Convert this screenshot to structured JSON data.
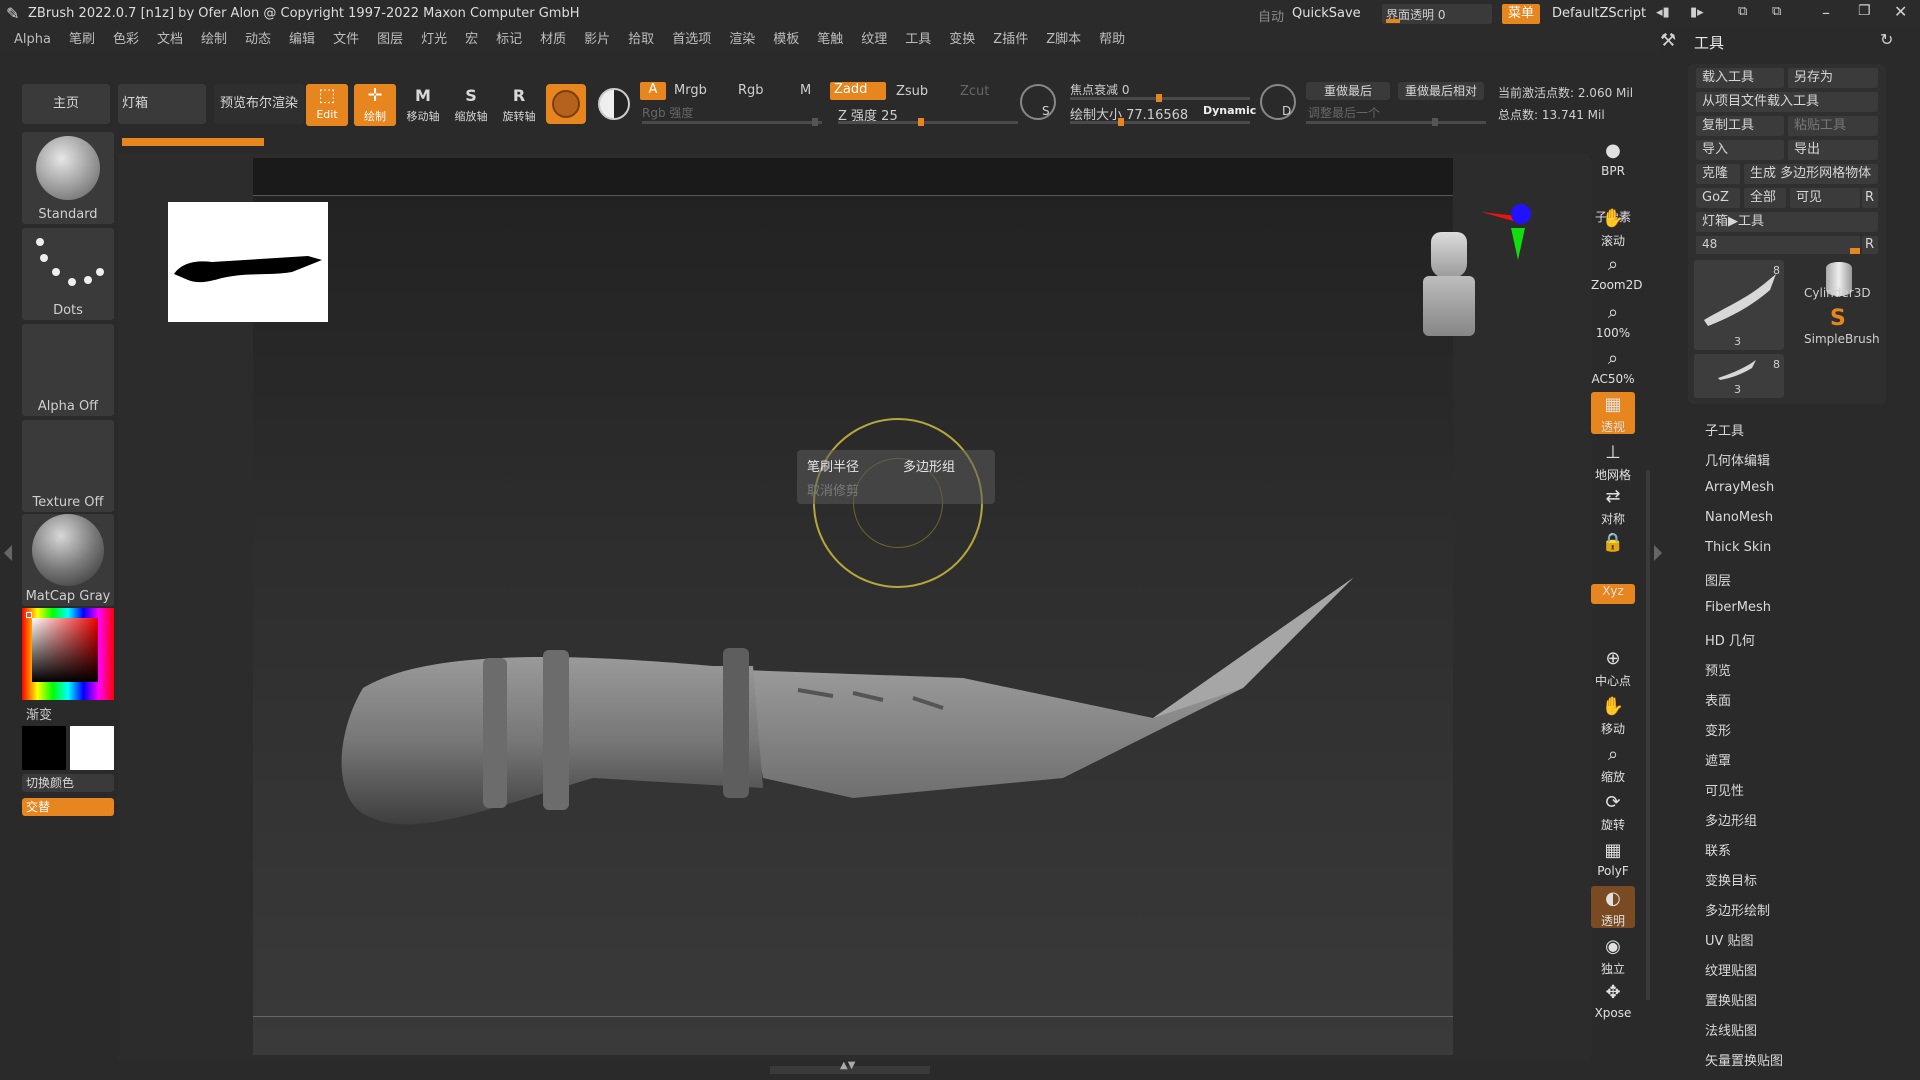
{
  "title_bar": {
    "title": "ZBrush 2022.0.7 [n1z] by Ofer Alon @ Copyright 1997-2022 Maxon Computer GmbH",
    "auto_label": "自动",
    "quicksave": "QuickSave",
    "transparency_label": "界面透明 0",
    "menu_label": "菜单",
    "script_label": "DefaultZScript"
  },
  "menubar": [
    "Alpha",
    "笔刷",
    "色彩",
    "文档",
    "绘制",
    "动态",
    "编辑",
    "文件",
    "图层",
    "灯光",
    "宏",
    "标记",
    "材质",
    "影片",
    "拾取",
    "首选项",
    "渲染",
    "模板",
    "笔触",
    "纹理",
    "工具",
    "变换",
    "Z插件",
    "Z脚本",
    "帮助"
  ],
  "top_toolbar": {
    "home": "主页",
    "lightbox": "灯箱",
    "preview_bpr": "预览布尔渲染",
    "edit": "Edit",
    "draw": "绘制",
    "move": "移动轴",
    "scale": "缩放轴",
    "rotate": "旋转轴",
    "a_label": "A",
    "mrgb": "Mrgb",
    "rgb": "Rgb",
    "m": "M",
    "zadd": "Zadd",
    "zsub": "Zsub",
    "zcut": "Zcut",
    "rgb_intensity": "Rgb 强度",
    "z_intensity": "Z 强度 25",
    "focal_shift": "焦点衰减 0",
    "draw_size": "绘制大小 77.16568",
    "dynamic": "Dynamic",
    "replay_last": "重做最后",
    "replay_last_rel": "重做最后相对",
    "adjust_last": "调整最后一个",
    "active_points": "当前激活点数: 2.060 Mil",
    "total_points": "总点数: 13.741 Mil",
    "s_label": "S",
    "d_label": "D"
  },
  "left_shelf": {
    "brush": "Standard",
    "stroke": "Dots",
    "alpha": "Alpha Off",
    "texture": "Texture Off",
    "material": "MatCap Gray",
    "gradient": "渐变",
    "switch_color": "切换颜色",
    "alternate": "交替"
  },
  "viewport": {
    "popup_brush_radius": "笔刷半径",
    "popup_polygroup": "多边形组",
    "popup_cancel": "取消修剪"
  },
  "right_tools": [
    {
      "name": "bpr",
      "label": "BPR",
      "icon": "sphere-icon"
    },
    {
      "name": "subpixel",
      "label": "子像素",
      "icon": "none"
    },
    {
      "name": "scroll",
      "label": "滚动",
      "icon": "hand-icon"
    },
    {
      "name": "zoom2d",
      "label": "Zoom2D",
      "icon": "zoom-icon"
    },
    {
      "name": "zoom100",
      "label": "100%",
      "icon": "zoom-icon"
    },
    {
      "name": "ac50",
      "label": "AC50%",
      "icon": "zoom-icon"
    },
    {
      "name": "perspective",
      "label": "透视",
      "icon": "grid-icon"
    },
    {
      "name": "floor",
      "label": "地网格",
      "icon": "floor-icon"
    },
    {
      "name": "symmetry",
      "label": "对称",
      "icon": "arrows-icon"
    },
    {
      "name": "lock",
      "label": "",
      "icon": "lock-icon"
    },
    {
      "name": "xyz",
      "label": "Xyz",
      "icon": "xyz-icon"
    },
    {
      "name": "center",
      "label": "中心点",
      "icon": "center-icon"
    },
    {
      "name": "move",
      "label": "移动",
      "icon": "hand-icon"
    },
    {
      "name": "scale",
      "label": "缩放",
      "icon": "zoom-icon"
    },
    {
      "name": "rotate",
      "label": "旋转",
      "icon": "rotate-icon"
    },
    {
      "name": "polyf",
      "label": "PolyF",
      "icon": "grid-icon"
    },
    {
      "name": "transp",
      "label": "透明",
      "icon": "ghost-icon"
    },
    {
      "name": "solo",
      "label": "独立",
      "icon": "solo-icon"
    },
    {
      "name": "xpose",
      "label": "Xpose",
      "icon": "xpose-icon"
    }
  ],
  "tool_panel": {
    "title": "工具",
    "load_tool": "载入工具",
    "save_as": "另存为",
    "load_from_project": "从项目文件载入工具",
    "copy_tool": "复制工具",
    "paste_tool": "粘贴工具",
    "import": "导入",
    "export": "导出",
    "clone": "克隆",
    "make_polymesh": "生成 多边形网格物体",
    "goz": "GoZ",
    "all": "全部",
    "visible": "可见",
    "r": "R",
    "lightbox_tool": "灯箱▶工具",
    "count": "48",
    "thumb1_count": "8",
    "thumb1_sub": "3",
    "thumb2_count": "8",
    "thumb2_sub": "3",
    "cylinder": "Cylinder3D",
    "simplebrush": "SimpleBrush"
  },
  "tool_menu": [
    "子工具",
    "几何体编辑",
    "ArrayMesh",
    "NanoMesh",
    "Thick Skin",
    "图层",
    "FiberMesh",
    "HD 几何",
    "预览",
    "表面",
    "变形",
    "遮罩",
    "可见性",
    "多边形组",
    "联系",
    "变换目标",
    "多边形绘制",
    "UV 贴图",
    "纹理贴图",
    "置换贴图",
    "法线贴图",
    "矢量置换贴图"
  ],
  "colors": {
    "accent": "#e7851f",
    "bg": "#2a2a2a",
    "panel": "#2f2f2f"
  }
}
